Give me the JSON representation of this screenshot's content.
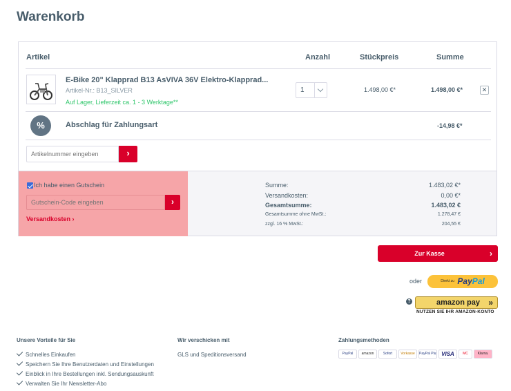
{
  "page": {
    "title": "Warenkorb"
  },
  "cart": {
    "headers": {
      "article": "Artikel",
      "quantity": "Anzahl",
      "unit_price": "Stückpreis",
      "sum": "Summe"
    },
    "item": {
      "name": "E-Bike 20\" Klapprad B13 AsVIVA 36V Elektro-Klapprad...",
      "sku": "Artikel-Nr.: B13_SILVER",
      "stock": "Auf Lager, Lieferzeit ca. 1 - 3 Werktage**",
      "quantity": "1",
      "unit_price": "1.498,00 €*",
      "sum": "1.498,00 €*",
      "remove_label": "✕"
    },
    "discount": {
      "icon_text": "%",
      "label": "Abschlag für Zahlungsart",
      "amount": "-14,98 €*"
    },
    "article_input": {
      "placeholder": "Artikelnummer eingeben",
      "button": "›"
    }
  },
  "voucher": {
    "checkbox_label": "Ich habe einen Gutschein",
    "checked": true,
    "input_placeholder": "Gutschein-Code eingeben",
    "button": "›",
    "shipping_link": "Versandkosten ›"
  },
  "totals": {
    "sum_label": "Summe:",
    "sum_value": "1.483,02 €*",
    "shipping_label": "Versandkosten:",
    "shipping_value": "0,00 €*",
    "total_label": "Gesamtsumme:",
    "total_value": "1.483,02 €",
    "net_label": "Gesamtsumme ohne MwSt.:",
    "net_value": "1.278,47 €",
    "tax_label": "zzgl. 16 % MwSt.:",
    "tax_value": "204,55 €"
  },
  "checkout": {
    "button": "Zur Kasse",
    "button_arrow": "›",
    "or_label": "oder",
    "paypal": {
      "prefix": "Direkt zu",
      "pay": "Pay",
      "pal": "Pal"
    },
    "help_icon": "?",
    "amazon": {
      "label": "amazon pay",
      "arrows": "»",
      "note": "NUTZEN SIE IHR AMAZON-KONTO"
    }
  },
  "footer": {
    "benefits": {
      "title": "Unsere Vorteile für Sie",
      "items": [
        "Schnelles Einkaufen",
        "Speichern Sie Ihre Benutzerdaten und Einstellungen",
        "Einblick in Ihre Bestellungen inkl. Sendungsauskunft",
        "Verwalten Sie Ihr Newsletter-Abo"
      ]
    },
    "shipping": {
      "title": "Wir verschicken mit",
      "text": "GLS und Speditionsversand"
    },
    "payment": {
      "title": "Zahlungsmethoden",
      "logos": [
        "PayPal",
        "amazon",
        "Sofort",
        "Vorkasse",
        "PayPal Plus",
        "VISA",
        "MC",
        "Klarna."
      ]
    }
  },
  "colors": {
    "accent": "#d9002a",
    "text": "#475c6a",
    "highlight": "#f6a5a8",
    "stock_green": "#2ec66a"
  }
}
